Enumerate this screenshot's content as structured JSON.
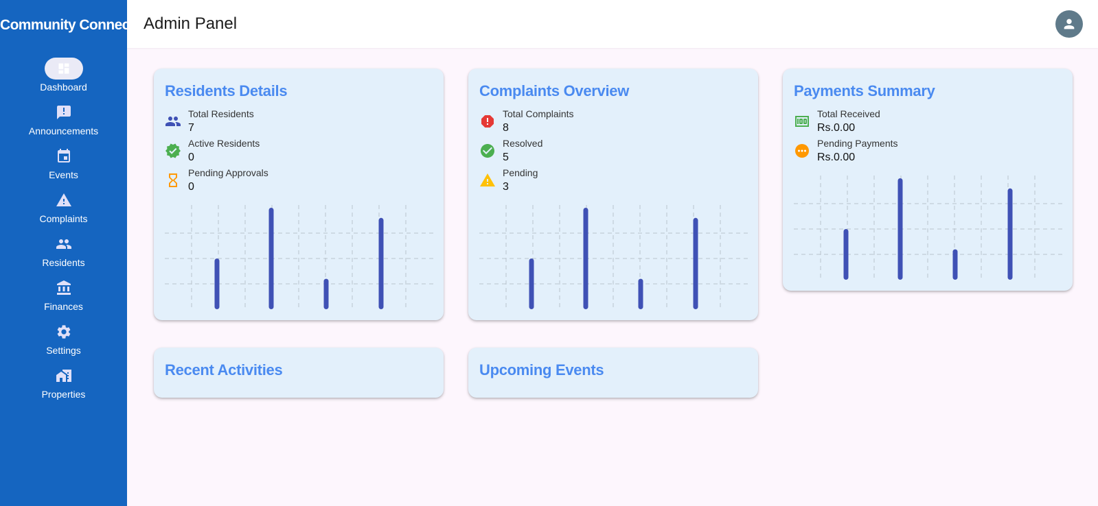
{
  "app": {
    "brand": "Community Connect",
    "page_title": "Admin Panel"
  },
  "sidebar": {
    "items": [
      {
        "label": "Dashboard",
        "icon": "dashboard-icon",
        "active": true
      },
      {
        "label": "Announcements",
        "icon": "announcement-icon"
      },
      {
        "label": "Events",
        "icon": "calendar-icon"
      },
      {
        "label": "Complaints",
        "icon": "warning-icon"
      },
      {
        "label": "Residents",
        "icon": "people-icon"
      },
      {
        "label": "Finances",
        "icon": "bank-icon"
      },
      {
        "label": "Settings",
        "icon": "gear-icon"
      },
      {
        "label": "Properties",
        "icon": "home-work-icon"
      }
    ]
  },
  "header": {
    "avatar_icon": "account-icon"
  },
  "cards": {
    "residents": {
      "title": "Residents Details",
      "stats": [
        {
          "label": "Total Residents",
          "value": "7",
          "icon": "people-icon",
          "color": "#3f51b5"
        },
        {
          "label": "Active Residents",
          "value": "0",
          "icon": "verified-icon",
          "color": "#4caf50"
        },
        {
          "label": "Pending Approvals",
          "value": "0",
          "icon": "hourglass-icon",
          "color": "#ff9800"
        }
      ]
    },
    "complaints": {
      "title": "Complaints Overview",
      "stats": [
        {
          "label": "Total Complaints",
          "value": "8",
          "icon": "error-octagon-icon",
          "color": "#e53935"
        },
        {
          "label": "Resolved",
          "value": "5",
          "icon": "check-circle-icon",
          "color": "#4caf50"
        },
        {
          "label": "Pending",
          "value": "3",
          "icon": "warning-icon",
          "color": "#ffc107"
        }
      ]
    },
    "payments": {
      "title": "Payments Summary",
      "stats": [
        {
          "label": "Total Received",
          "value": "Rs.0.00",
          "icon": "money-icon",
          "color": "#4caf50"
        },
        {
          "label": "Pending Payments",
          "value": "Rs.0.00",
          "icon": "pending-icon",
          "color": "#ff9800"
        }
      ]
    },
    "recent": {
      "title": "Recent Activities"
    },
    "upcoming": {
      "title": "Upcoming Events"
    }
  },
  "chart_data": [
    {
      "type": "bar",
      "card": "Residents Details",
      "values": [
        50,
        100,
        30,
        90
      ],
      "ylim": [
        0,
        100
      ],
      "color": "#3f51b5",
      "grid": true
    },
    {
      "type": "bar",
      "card": "Complaints Overview",
      "values": [
        50,
        100,
        30,
        90
      ],
      "ylim": [
        0,
        100
      ],
      "color": "#3f51b5",
      "grid": true
    },
    {
      "type": "bar",
      "card": "Payments Summary",
      "values": [
        50,
        100,
        30,
        90
      ],
      "ylim": [
        0,
        100
      ],
      "color": "#3f51b5",
      "grid": true
    }
  ]
}
